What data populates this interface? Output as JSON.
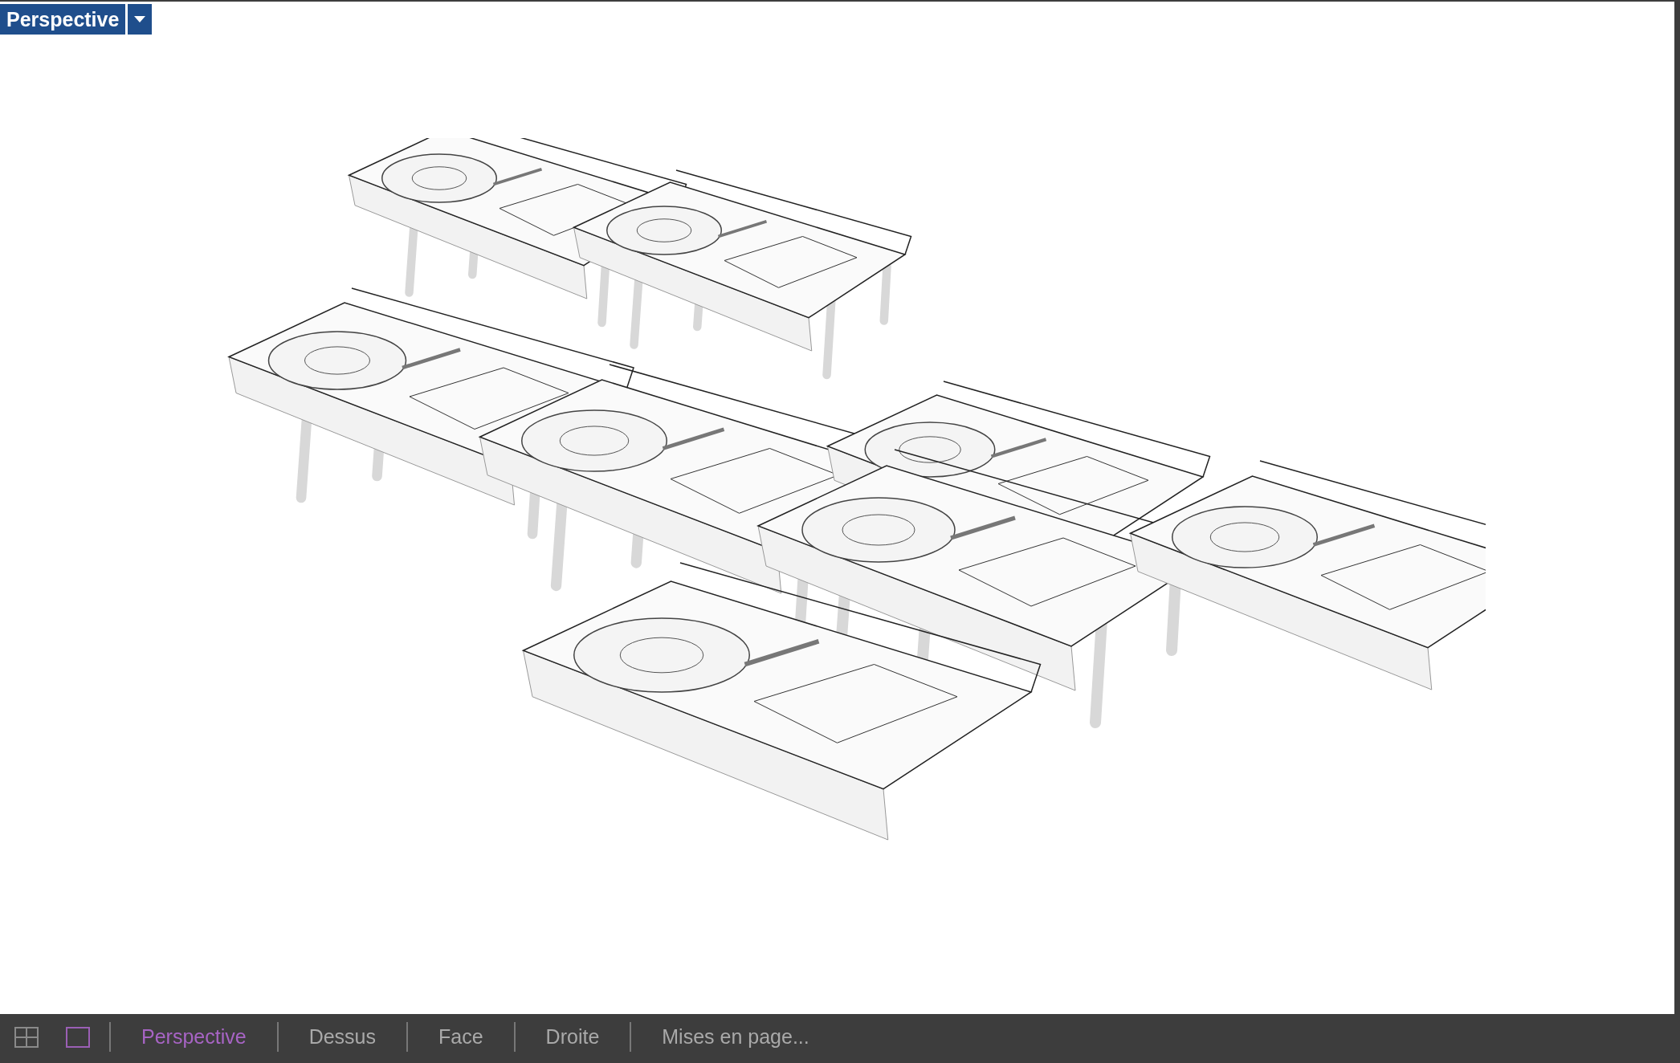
{
  "viewport": {
    "title": "Perspective"
  },
  "tabs": [
    {
      "label": "Perspective",
      "selected": true
    },
    {
      "label": "Dessus",
      "selected": false
    },
    {
      "label": "Face",
      "selected": false
    },
    {
      "label": "Droite",
      "selected": false
    },
    {
      "label": "Mises en page...",
      "selected": false
    }
  ]
}
